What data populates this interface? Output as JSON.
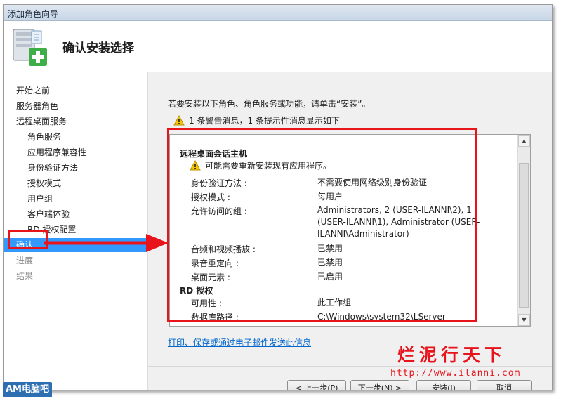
{
  "window": {
    "title": "添加角色向导"
  },
  "header": {
    "heading": "确认安装选择"
  },
  "sidebar": {
    "items": [
      {
        "label": "开始之前",
        "level": 0,
        "state": "normal"
      },
      {
        "label": "服务器角色",
        "level": 0,
        "state": "normal"
      },
      {
        "label": "远程桌面服务",
        "level": 0,
        "state": "normal"
      },
      {
        "label": "角色服务",
        "level": 1,
        "state": "normal"
      },
      {
        "label": "应用程序兼容性",
        "level": 1,
        "state": "normal"
      },
      {
        "label": "身份验证方法",
        "level": 1,
        "state": "normal"
      },
      {
        "label": "授权模式",
        "level": 1,
        "state": "normal"
      },
      {
        "label": "用户组",
        "level": 1,
        "state": "normal"
      },
      {
        "label": "客户端体验",
        "level": 1,
        "state": "normal"
      },
      {
        "label": "RD 授权配置",
        "level": 1,
        "state": "normal"
      },
      {
        "label": "确认",
        "level": 0,
        "state": "active"
      },
      {
        "label": "进度",
        "level": 0,
        "state": "disabled"
      },
      {
        "label": "结果",
        "level": 0,
        "state": "disabled"
      }
    ]
  },
  "main": {
    "intro": "若要安装以下角色、角色服务或功能，请单击“安装”。",
    "summary": "1 条警告消息，1 条提示性消息显示如下",
    "details": {
      "section1": {
        "title": "远程桌面会话主机",
        "warning": "可能需要重新安装现有应用程序。",
        "rows": [
          {
            "label": "身份验证方法 :",
            "value": "不需要使用网络级别身份验证"
          },
          {
            "label": "授权模式 :",
            "value": "每用户"
          },
          {
            "label": "允许访问的组 :",
            "value": "Administrators, 2 (USER-ILANNI\\2), 1 (USER-ILANNI\\1), Administrator (USER-ILANNI\\Administrator)"
          },
          {
            "label": "音频和视频播放 :",
            "value": "已禁用"
          },
          {
            "label": "录音重定向 :",
            "value": "已禁用"
          },
          {
            "label": "桌面元素 :",
            "value": "已启用"
          }
        ]
      },
      "section2": {
        "title": "RD 授权",
        "rows": [
          {
            "label": "可用性 :",
            "value": "此工作组"
          },
          {
            "label": "数据库路径 :",
            "value": "C:\\Windows\\system32\\LServer"
          }
        ]
      }
    },
    "link": "打印、保存或通过电子邮件发送此信息"
  },
  "footer": {
    "back_button": "< 上一步(P)",
    "next_button": "下一步(N) >",
    "install_button": "安装(I)",
    "cancel_button": "取消"
  },
  "watermark": {
    "brand": "烂泥行天下",
    "site": "http://www.ilanni.com",
    "logo": "AM电脑吧"
  },
  "colors": {
    "selection": "#3399ff",
    "annotation": "#e8141c",
    "link": "#0066cc",
    "warning": "#f5c400"
  }
}
